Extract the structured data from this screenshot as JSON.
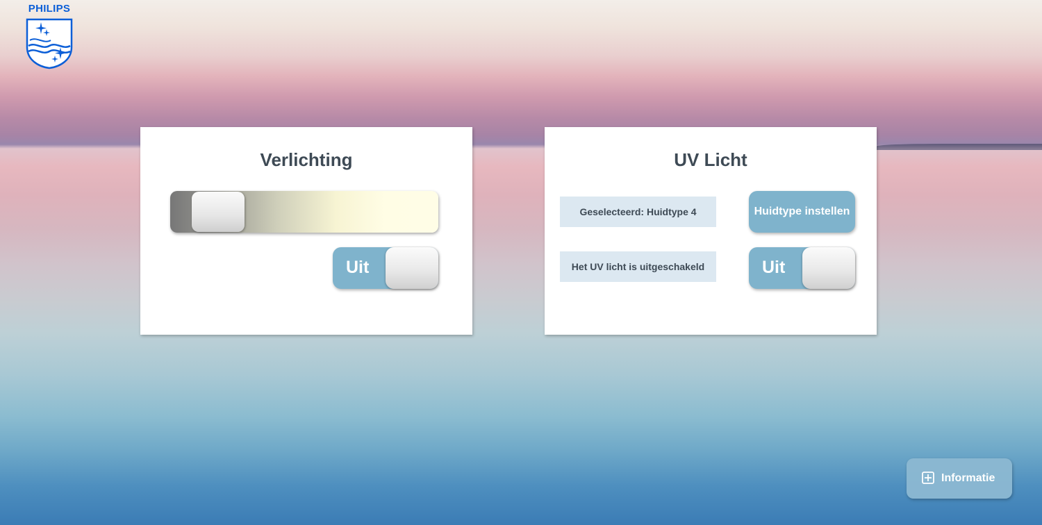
{
  "brand": {
    "name": "PHILIPS",
    "logo_icon": "philips-shield-logo"
  },
  "lighting_panel": {
    "title": "Verlichting",
    "brightness_slider": {
      "level": 0.1,
      "gradient_colors": [
        "#777777",
        "#cfcfba",
        "#fffde5"
      ]
    },
    "toggle": {
      "label": "Uit",
      "state": "off"
    }
  },
  "uv_panel": {
    "title": "UV Licht",
    "selected_text": "Geselecteerd: Huidtype 4",
    "set_skin_type_label": "Huidtype instellen",
    "status_text": "Het UV licht is uitgeschakeld",
    "toggle": {
      "label": "Uit",
      "state": "off"
    }
  },
  "info_button": {
    "label": "Informatie",
    "icon": "plus-square-icon"
  },
  "colors": {
    "accent": "#7fb3cc",
    "text_dark": "#3e4a55",
    "info_box_bg": "#dce8f1",
    "logo_blue": "#0b5ed7"
  }
}
